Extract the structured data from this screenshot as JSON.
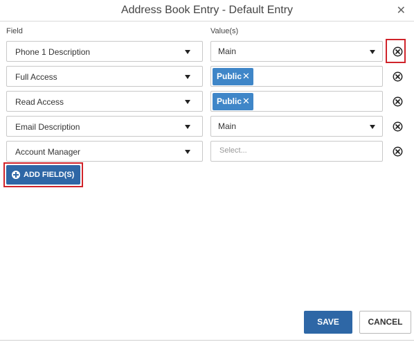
{
  "dialog": {
    "title": "Address Book Entry - Default Entry",
    "close_icon": "close-icon"
  },
  "columns": {
    "field_label": "Field",
    "value_label": "Value(s)"
  },
  "rows": [
    {
      "field": "Phone 1 Description",
      "value_type": "select",
      "value": "Main"
    },
    {
      "field": "Full Access",
      "value_type": "tags",
      "tags": [
        "Public"
      ]
    },
    {
      "field": "Read Access",
      "value_type": "tags",
      "tags": [
        "Public"
      ]
    },
    {
      "field": "Email Description",
      "value_type": "select",
      "value": "Main"
    },
    {
      "field": "Account Manager",
      "value_type": "placeholder",
      "placeholder": "Select..."
    }
  ],
  "tag_remove_glyph": "✕",
  "buttons": {
    "add_field": "ADD FIELD(S)",
    "save": "SAVE",
    "cancel": "CANCEL"
  },
  "colors": {
    "primary": "#2e67a6",
    "tag": "#3f86c8",
    "highlight": "#d0232a"
  },
  "icons": {
    "dropdown": "chevron-down-icon",
    "remove_row": "remove-circle-icon",
    "add": "plus-circle-icon"
  }
}
